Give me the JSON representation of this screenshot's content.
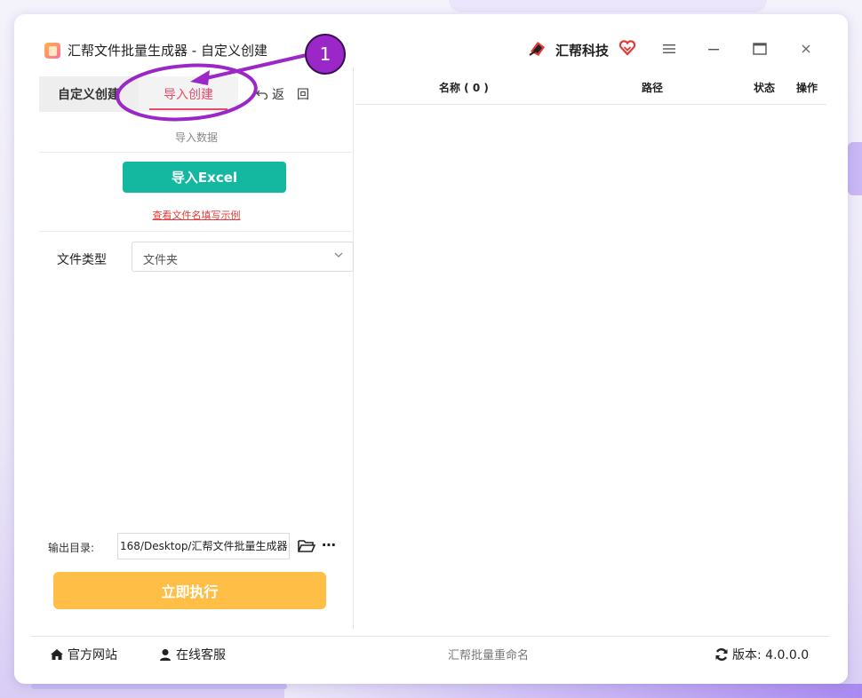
{
  "app": {
    "title": "汇帮文件批量生成器 - 自定义创建",
    "brand": "汇帮科技"
  },
  "tabs": {
    "custom": "自定义创建",
    "import": "导入创建",
    "back": "返　回"
  },
  "import_section": {
    "hint": "导入数据",
    "button": "导入Excel",
    "example_link": "查看文件名填写示例"
  },
  "file_type": {
    "label": "文件类型",
    "value": "文件夹"
  },
  "output": {
    "label": "输出目录:",
    "path": "168/Desktop/汇帮文件批量生成器"
  },
  "run_button": "立即执行",
  "table": {
    "col_name": "名称 ( 0 )",
    "col_path": "路径",
    "col_status": "状态",
    "col_action": "操作"
  },
  "footer": {
    "site": "官方网站",
    "support": "在线客服",
    "center": "汇帮批量重命名",
    "version": "版本: 4.0.0.0"
  },
  "annotation": {
    "step": "1",
    "color": "#9b27c9"
  },
  "colors": {
    "accent_teal": "#14b8a0",
    "accent_orange": "#ffbf47",
    "accent_red": "#e74c6c"
  }
}
